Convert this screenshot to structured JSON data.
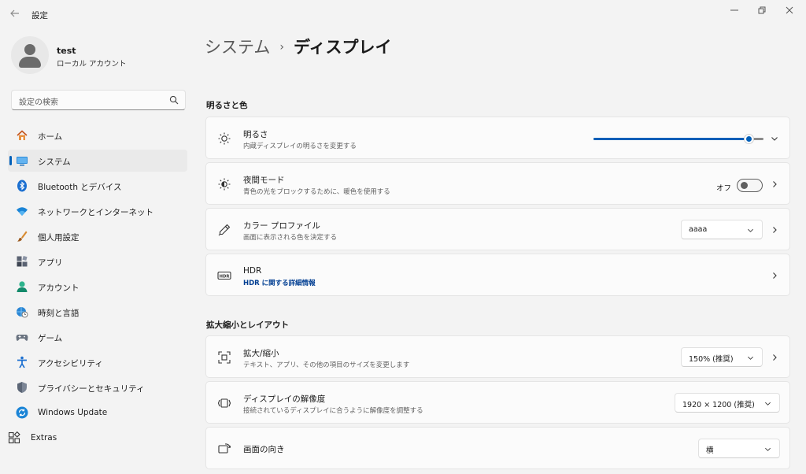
{
  "window": {
    "title": "設定",
    "controls": {
      "minimize": "—",
      "maximize": "❐",
      "close": "✕"
    }
  },
  "user": {
    "name": "test",
    "account_type": "ローカル アカウント"
  },
  "search": {
    "placeholder": "設定の検索"
  },
  "sidebar": {
    "selected": "システム",
    "items": [
      {
        "label": "ホーム",
        "icon": "home-icon"
      },
      {
        "label": "システム",
        "icon": "system-icon"
      },
      {
        "label": "Bluetooth とデバイス",
        "icon": "bluetooth-icon"
      },
      {
        "label": "ネットワークとインターネット",
        "icon": "wifi-icon"
      },
      {
        "label": "個人用設定",
        "icon": "brush-icon"
      },
      {
        "label": "アプリ",
        "icon": "apps-icon"
      },
      {
        "label": "アカウント",
        "icon": "account-icon"
      },
      {
        "label": "時刻と言語",
        "icon": "globe-clock-icon"
      },
      {
        "label": "ゲーム",
        "icon": "gamepad-icon"
      },
      {
        "label": "アクセシビリティ",
        "icon": "accessibility-icon"
      },
      {
        "label": "プライバシーとセキュリティ",
        "icon": "shield-icon"
      },
      {
        "label": "Windows Update",
        "icon": "update-icon"
      },
      {
        "label": "Extras",
        "icon": "extras-icon"
      }
    ]
  },
  "breadcrumb": {
    "parent": "システム",
    "separator": "›",
    "current": "ディスプレイ"
  },
  "sections": {
    "brightness_color": {
      "title": "明るさと色",
      "brightness": {
        "title": "明るさ",
        "subtitle": "内蔵ディスプレイの明るさを変更する",
        "level_fraction": 0.91
      },
      "night_light": {
        "title": "夜間モード",
        "subtitle": "青色の光をブロックするために、暖色を使用する",
        "state": "オフ"
      },
      "color_profile": {
        "title": "カラー プロファイル",
        "subtitle": "画面に表示される色を決定する",
        "value": "aaaa"
      },
      "hdr": {
        "title": "HDR",
        "link": "HDR に関する詳細情報"
      }
    },
    "scale_layout": {
      "title": "拡大縮小とレイアウト",
      "scale": {
        "title": "拡大/縮小",
        "subtitle": "テキスト、アプリ、その他の項目のサイズを変更します",
        "value": "150% (推奨)"
      },
      "resolution": {
        "title": "ディスプレイの解像度",
        "subtitle": "接続されているディスプレイに合うように解像度を調整する",
        "value": "1920 × 1200 (推奨)"
      },
      "orientation": {
        "title": "画面の向き",
        "value": "横"
      }
    }
  },
  "colors": {
    "accent": "#005fb8",
    "link": "#003e92",
    "background": "#f3f3f3",
    "card": "#fbfbfb"
  }
}
